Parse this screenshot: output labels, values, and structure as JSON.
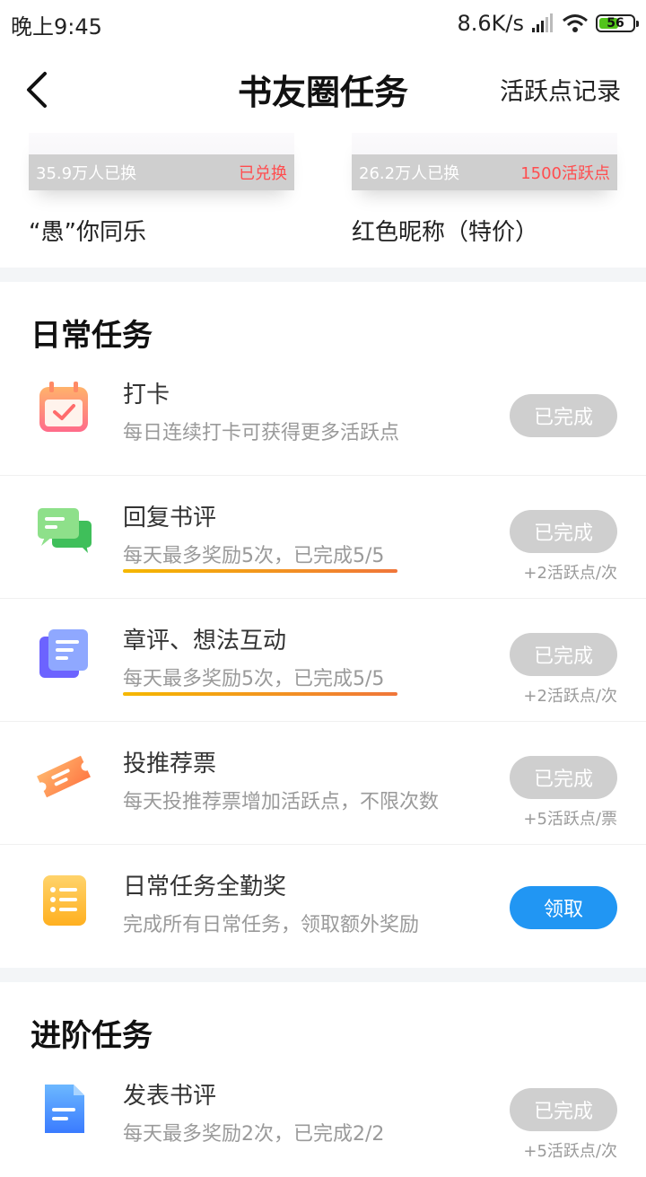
{
  "status_bar": {
    "time": "晚上9:45",
    "network_speed": "8.6K/s",
    "battery_percent": "56",
    "battery_level": 0.56,
    "battery_color": "#52c41a"
  },
  "header": {
    "title": "书友圈任务",
    "right_link": "活跃点记录"
  },
  "rewards": [
    {
      "count": "35.9万人已换",
      "status": "已兑换",
      "name": "“愚”你同乐"
    },
    {
      "count": "26.2万人已换",
      "status": "1500活跃点",
      "name": "红色昵称（特价）"
    }
  ],
  "sections": {
    "daily": {
      "title": "日常任务",
      "tasks": [
        {
          "title": "打卡",
          "desc": "每日连续打卡可获得更多活跃点",
          "button": "已完成",
          "reward": "",
          "icon": "calendar-check-icon"
        },
        {
          "title": "回复书评",
          "desc": "每天最多奖励5次，已完成5/5",
          "button": "已完成",
          "reward": "+2活跃点/次",
          "icon": "chat-bubbles-icon"
        },
        {
          "title": "章评、想法互动",
          "desc": "每天最多奖励5次，已完成5/5",
          "button": "已完成",
          "reward": "+2活跃点/次",
          "icon": "notes-stack-icon"
        },
        {
          "title": "投推荐票",
          "desc": "每天投推荐票增加活跃点，不限次数",
          "button": "已完成",
          "reward": "+5活跃点/票",
          "icon": "ticket-icon"
        },
        {
          "title": "日常任务全勤奖",
          "desc": "完成所有日常任务，领取额外奖励",
          "button": "领取",
          "reward": "",
          "icon": "list-icon"
        }
      ]
    },
    "advanced": {
      "title": "进阶任务",
      "tasks": [
        {
          "title": "发表书评",
          "desc": "每天最多奖励2次，已完成2/2",
          "button": "已完成",
          "reward": "+5活跃点/次",
          "icon": "document-icon"
        }
      ]
    }
  },
  "colors": {
    "button_done": "#cfcfcf",
    "button_primary": "#2196f3",
    "highlight_underline": "#f0763a",
    "reward_status_red": "#ff4d4f"
  }
}
